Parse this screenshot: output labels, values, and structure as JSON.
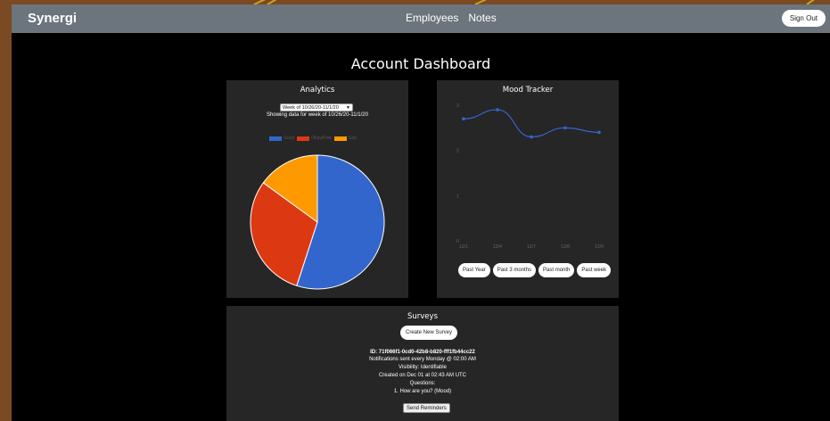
{
  "brand": "Synergi",
  "nav": {
    "employees": "Employees",
    "notes": "Notes",
    "sign_out": "Sign Out"
  },
  "page_title": "Account Dashboard",
  "analytics": {
    "title": "Analytics",
    "week_select": "Week of 10/26/20-11/1/20",
    "showing": "Showing data for week of 10/26/20-11/1/20",
    "legend": [
      {
        "label": "Good",
        "color": "#3366cc"
      },
      {
        "label": "Okay/Fine",
        "color": "#dc3912"
      },
      {
        "label": "Sad",
        "color": "#ff9900"
      }
    ]
  },
  "mood": {
    "title": "Mood Tracker",
    "buttons": [
      "Past Year",
      "Past 3 months",
      "Past month",
      "Past week"
    ]
  },
  "surveys": {
    "title": "Surveys",
    "create": "Create New Survey",
    "id_line": "ID: 71f066f1-0cd0-42b8-b820-fff1fb44cc22",
    "notifications": "Notifications sent every Monday @ 02:00 AM",
    "visibility": "Visibility: Identifiable",
    "created": "Created on Dec 01 at 02:43 AM UTC",
    "questions_label": "Questions:",
    "question_1": "1. How are you? (Mood)",
    "send": "Send Reminders"
  },
  "chart_data": [
    {
      "type": "pie",
      "categories": [
        "Good",
        "Okay/Fine",
        "Sad"
      ],
      "values": [
        55,
        30,
        15
      ],
      "colors": [
        "#3366cc",
        "#dc3912",
        "#ff9900"
      ],
      "legend": "top"
    },
    {
      "type": "line",
      "x": [
        "12/1",
        "12/4",
        "12/7",
        "12/8",
        "12/9"
      ],
      "values": [
        2.7,
        2.9,
        2.3,
        2.5,
        2.4
      ],
      "yticks": [
        0,
        1,
        2,
        3
      ],
      "ylim": [
        0,
        3
      ],
      "color": "#3366cc",
      "grid": false
    }
  ]
}
